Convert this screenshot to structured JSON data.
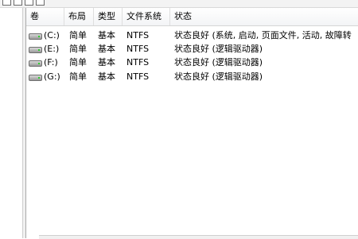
{
  "columns": {
    "volume": "卷",
    "layout": "布局",
    "type": "类型",
    "filesystem": "文件系统",
    "status": "状态"
  },
  "rows": [
    {
      "volume": "(C:)",
      "layout": "简单",
      "type": "基本",
      "filesystem": "NTFS",
      "status": "状态良好 (系统, 启动, 页面文件, 活动, 故障转"
    },
    {
      "volume": "(E:)",
      "layout": "简单",
      "type": "基本",
      "filesystem": "NTFS",
      "status": "状态良好 (逻辑驱动器)"
    },
    {
      "volume": "(F:)",
      "layout": "简单",
      "type": "基本",
      "filesystem": "NTFS",
      "status": "状态良好 (逻辑驱动器)"
    },
    {
      "volume": "(G:)",
      "layout": "简单",
      "type": "基本",
      "filesystem": "NTFS",
      "status": "状态良好 (逻辑驱动器)"
    }
  ],
  "icons": {
    "drive": "hard-drive-icon"
  }
}
